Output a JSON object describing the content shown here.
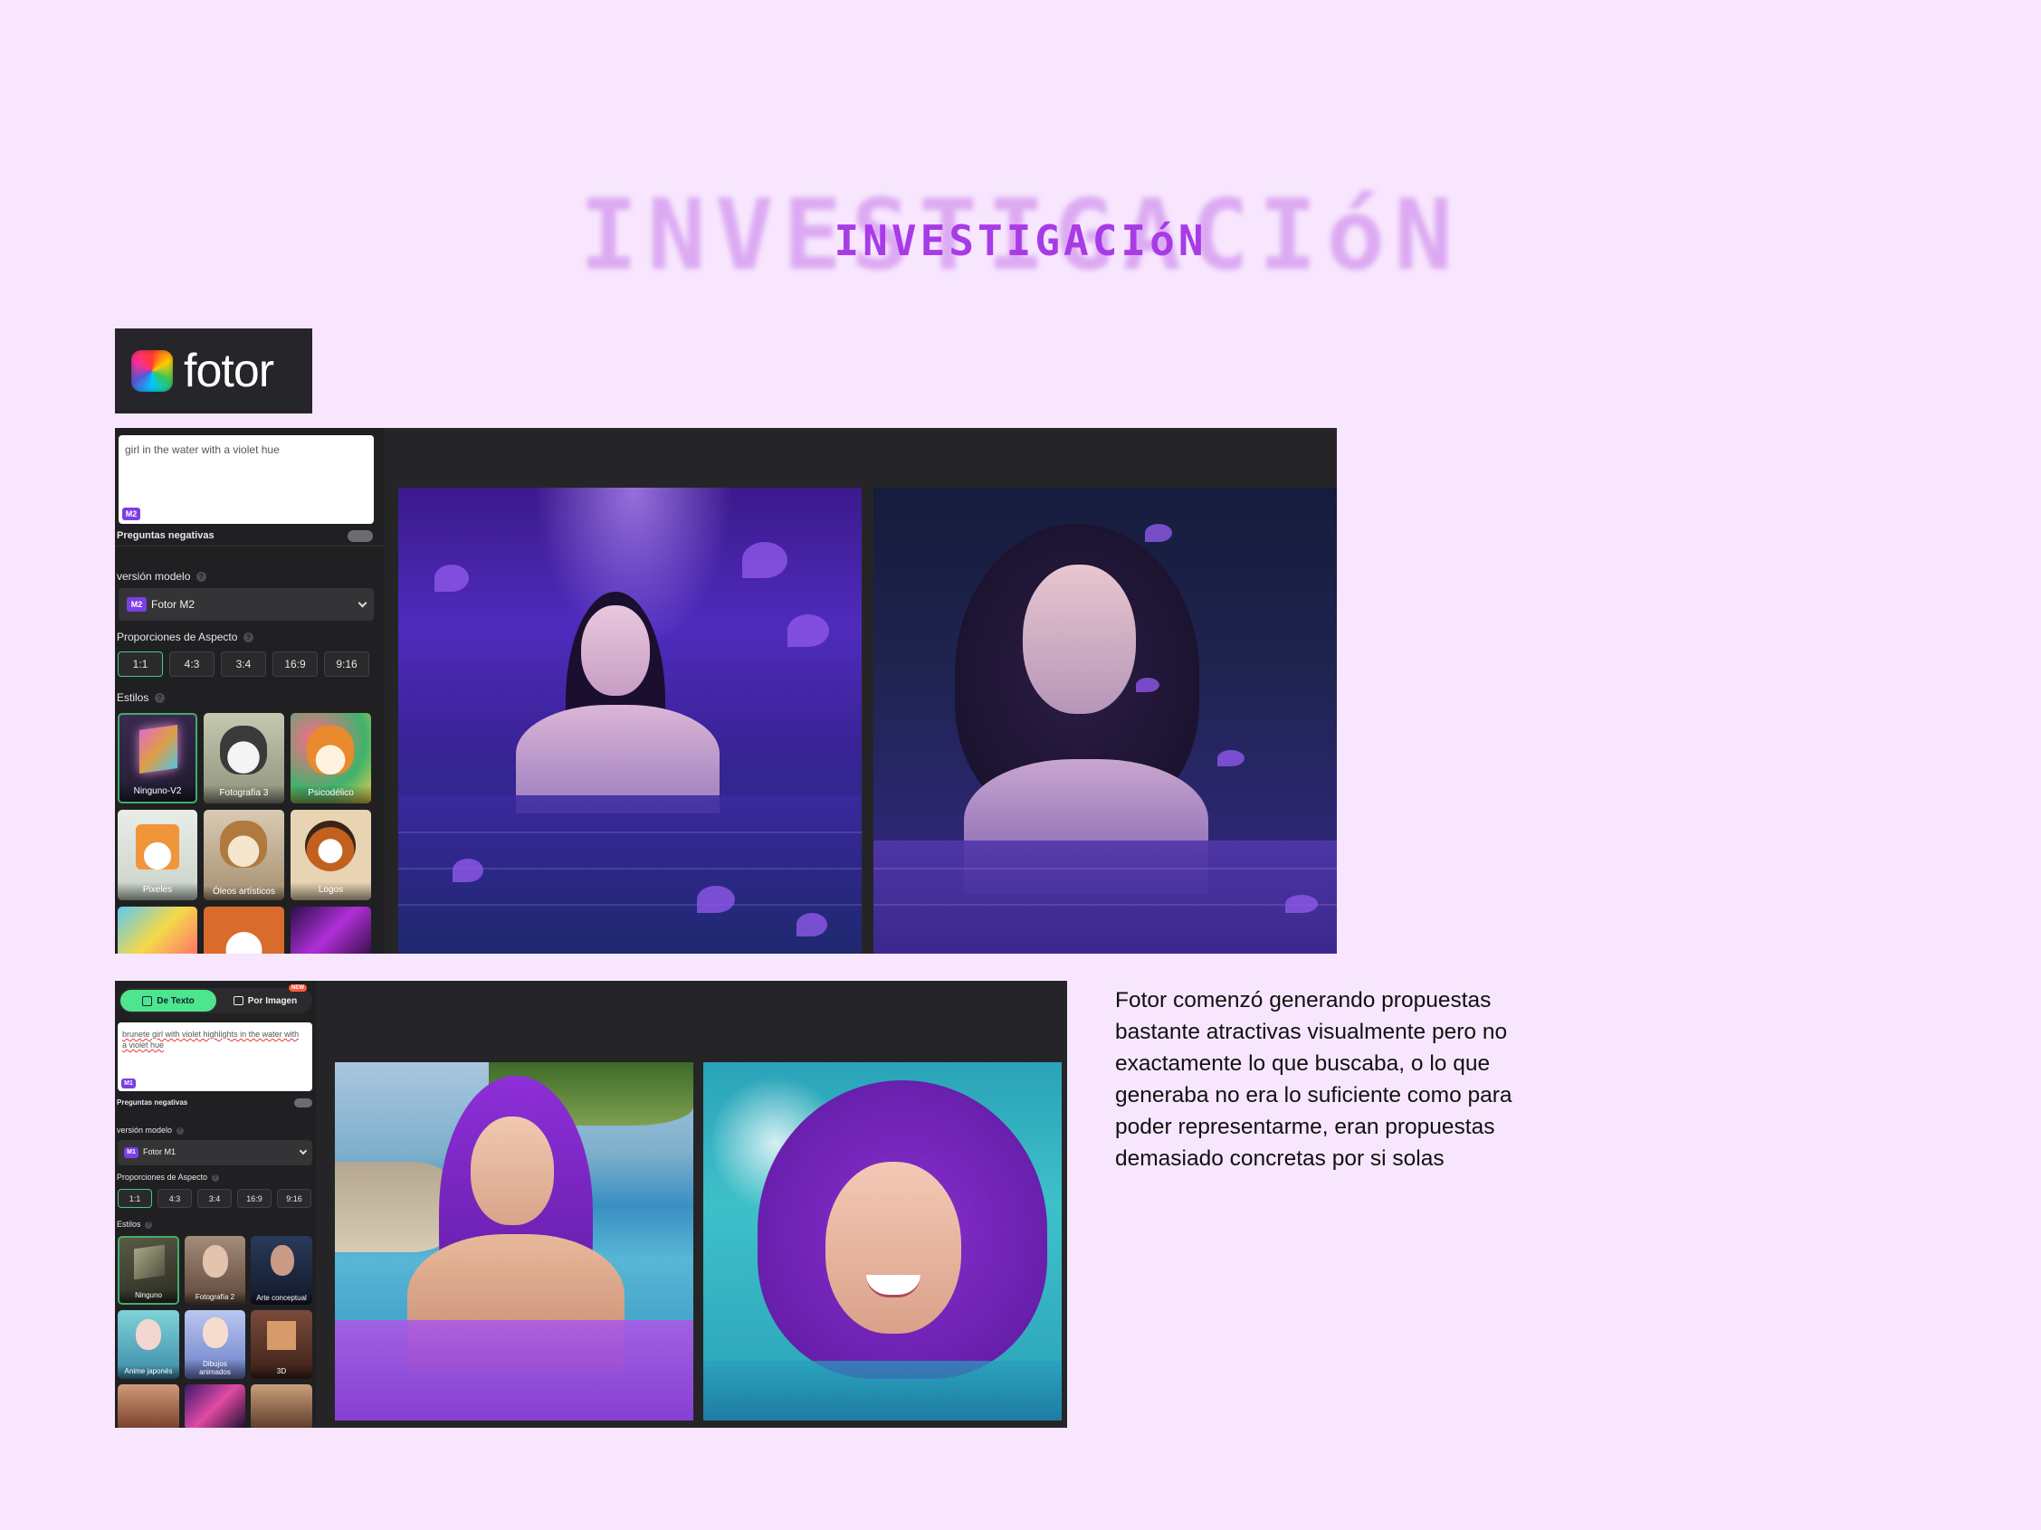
{
  "title": "INVESTIGACIóN",
  "logo": {
    "icon": "fotor-logo-icon",
    "text": "fotor"
  },
  "panel1": {
    "prompt": "girl in the water with a violet hue",
    "prompt_badge": "M2",
    "negative_label": "Preguntas negativas",
    "model_label": "versión modelo",
    "model_badge": "M2",
    "model_value": "Fotor M2",
    "aspect_label": "Proporciones de Aspecto",
    "ratios": [
      "1:1",
      "4:3",
      "3:4",
      "16:9",
      "9:16"
    ],
    "active_ratio": "1:1",
    "styles_label": "Estilos",
    "styles": [
      "Ninguno-V2",
      "Fotografía 3",
      "Psicodélico",
      "Pixeles",
      "Óleos artísticos",
      "Logos"
    ]
  },
  "panel2": {
    "tab_text": "De Texto",
    "tab_image": "Por Imagen",
    "tab_new": "NEW",
    "prompt": "brunete girl with violet highlights in the water with a violet hue",
    "prompt_badge": "M1",
    "negative_label": "Preguntas negativas",
    "model_label": "versión modelo",
    "model_badge": "M1",
    "model_value": "Fotor M1",
    "aspect_label": "Proporciones de Aspecto",
    "ratios": [
      "1:1",
      "4:3",
      "3:4",
      "16:9",
      "9:16"
    ],
    "styles_label": "Estilos",
    "styles": [
      "Ninguno",
      "Fotografía 2",
      "Arte conceptual",
      "Anime japonés",
      "Dibujos animados",
      "3D"
    ]
  },
  "description": "Fotor comenzó generando propuestas bastante atractivas visualmente pero no exactamente lo que buscaba, o lo que generaba no era lo suficiente como para poder representarme, eran propuestas demasiado concretas por si solas",
  "colors": {
    "background": "#f7e6fd",
    "title": "#a83be6",
    "accent": "#7b3fe4",
    "active_tab": "#4ee58f"
  }
}
